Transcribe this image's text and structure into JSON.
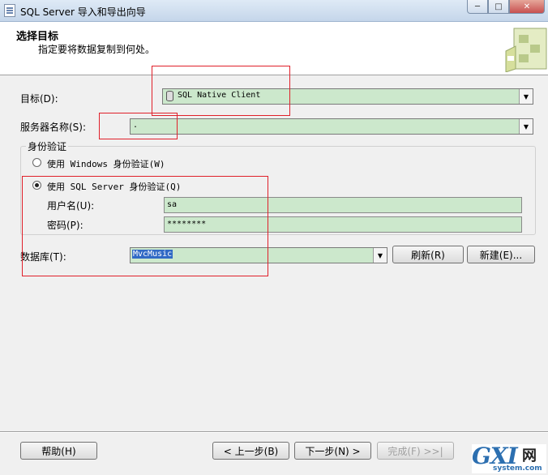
{
  "window": {
    "title": "SQL Server 导入和导出向导"
  },
  "header": {
    "title": "选择目标",
    "subtitle": "指定要将数据复制到何处。"
  },
  "destination": {
    "label": "目标(D):",
    "value": "SQL Native Client"
  },
  "server": {
    "label": "服务器名称(S):",
    "value": "."
  },
  "auth": {
    "group_label": "身份验证",
    "windows_option": "使用 Windows 身份验证(W)",
    "sql_option": "使用 SQL Server 身份验证(Q)",
    "selected": "sql",
    "username_label": "用户名(U):",
    "username_value": "sa",
    "password_label": "密码(P):",
    "password_value": "********"
  },
  "database": {
    "label": "数据库(T):",
    "value": "MvcMusic",
    "refresh_button": "刷新(R)",
    "new_button": "新建(E)..."
  },
  "footer": {
    "help_button": "帮助(H)",
    "back_button": "< 上一步(B)",
    "next_button": "下一步(N) >",
    "finish_button": "完成(F) >>|"
  },
  "watermark": {
    "logo": "GXI",
    "cn": "网",
    "site": "system.com"
  },
  "colors": {
    "input_bg": "#cce8cc",
    "annotation_red": "#e0202a"
  }
}
